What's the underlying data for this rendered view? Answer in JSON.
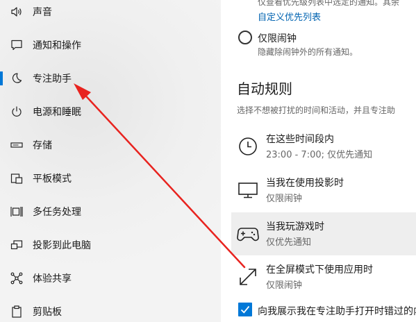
{
  "sidebar": {
    "items": [
      {
        "label": "声音",
        "icon": "speaker-icon"
      },
      {
        "label": "通知和操作",
        "icon": "notification-icon"
      },
      {
        "label": "专注助手",
        "icon": "moon-icon",
        "active": true
      },
      {
        "label": "电源和睡眠",
        "icon": "power-icon"
      },
      {
        "label": "存储",
        "icon": "storage-icon"
      },
      {
        "label": "平板模式",
        "icon": "tablet-icon"
      },
      {
        "label": "多任务处理",
        "icon": "multitask-icon"
      },
      {
        "label": "投影到此电脑",
        "icon": "project-icon"
      },
      {
        "label": "体验共享",
        "icon": "share-icon"
      },
      {
        "label": "剪贴板",
        "icon": "clipboard-icon"
      }
    ]
  },
  "main": {
    "top_text": "仅查看优先级列表中选定的通知。其余",
    "custom_priority_link": "自定义优先列表",
    "alarms_only": {
      "label": "仅限闹钟",
      "desc": "隐藏除闹钟外的所有通知。"
    },
    "auto_rules": {
      "title": "自动规则",
      "desc": "选择不想被打扰的时间和活动，并且专注助",
      "rules": [
        {
          "title": "在这些时间段内",
          "sub": "23:00 - 7:00; 仅优先通知",
          "icon": "clock-icon"
        },
        {
          "title": "当我在使用投影时",
          "sub": "仅限闹钟",
          "icon": "monitor-icon"
        },
        {
          "title": "当我玩游戏时",
          "sub": "仅优先通知",
          "icon": "gamepad-icon",
          "hover": true
        },
        {
          "title": "在全屏模式下使用应用时",
          "sub": "仅限闹钟",
          "icon": "fullscreen-icon"
        }
      ]
    },
    "summary_checkbox": {
      "label": "向我展示我在专注助手打开时错过的内容",
      "checked": true
    }
  },
  "colors": {
    "accent": "#0078d7",
    "link": "#0063b1",
    "annotation_arrow": "#e8231f"
  }
}
